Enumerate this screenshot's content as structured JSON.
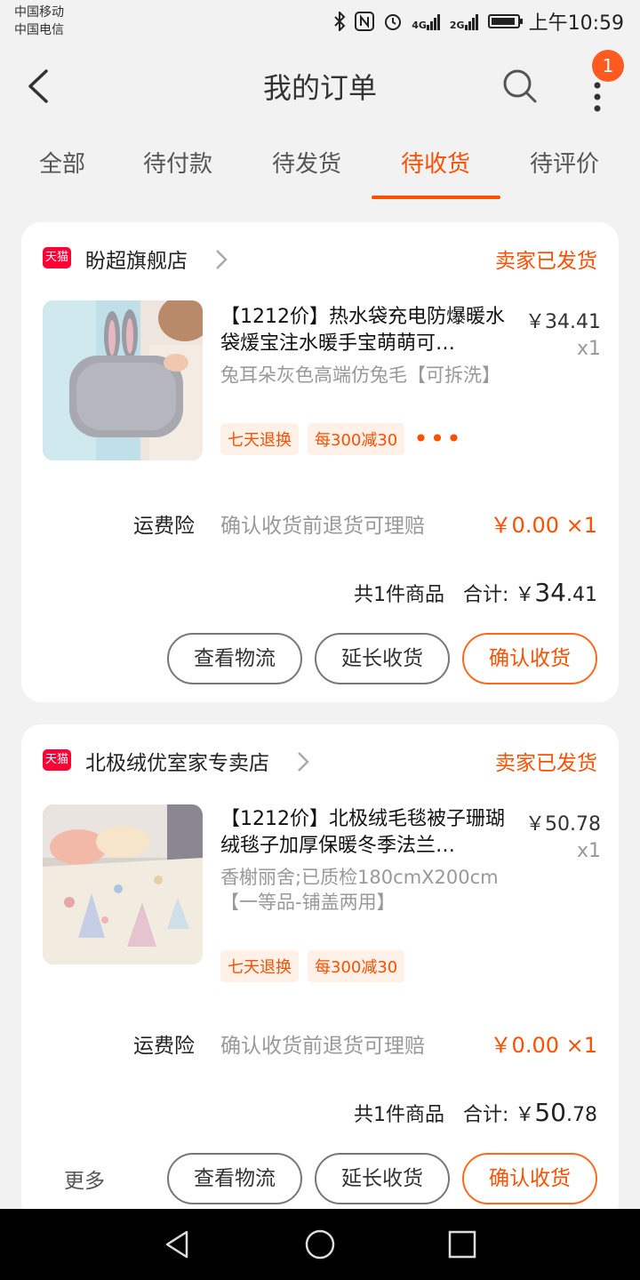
{
  "status_bar": {
    "carrier1": "中国移动",
    "carrier2": "中国电信",
    "net1": "4G",
    "net2": "2G",
    "time": "上午10:59"
  },
  "header": {
    "title": "我的订单",
    "badge_count": "1"
  },
  "tabs": [
    {
      "label": "全部"
    },
    {
      "label": "待付款"
    },
    {
      "label": "待发货"
    },
    {
      "label": "待收货",
      "active": true
    },
    {
      "label": "待评价"
    }
  ],
  "orders": [
    {
      "shop_tag": "天猫",
      "shop_name": "盼超旗舰店",
      "status": "卖家已发货",
      "title": "【1212价】热水袋充电防爆暖水袋煖宝注水暖手宝萌萌可…",
      "sku": "兔耳朵灰色高端仿兔毛【可拆洗】",
      "price": "￥34.41",
      "qty": "x1",
      "tags": [
        "七天退换",
        "每300减30"
      ],
      "tags_more": "•••",
      "insurance_label": "运费险",
      "insurance_desc": "确认收货前退货可理赔",
      "insurance_price": "￥0.00 ×1",
      "count_text": "共1件商品",
      "total_prefix": "合计: ￥",
      "total_int": "34",
      "total_dec": ".41",
      "buttons": [
        "查看物流",
        "延长收货",
        "确认收货"
      ]
    },
    {
      "shop_tag": "天猫",
      "shop_name": "北极绒优室家专卖店",
      "status": "卖家已发货",
      "title": "【1212价】北极绒毛毯被子珊瑚绒毯子加厚保暖冬季法兰…",
      "sku": "香榭丽舍;已质检180cmX200cm【一等品-铺盖两用】",
      "price": "￥50.78",
      "qty": "x1",
      "tags": [
        "七天退换",
        "每300减30"
      ],
      "insurance_label": "运费险",
      "insurance_desc": "确认收货前退货可理赔",
      "insurance_price": "￥0.00 ×1",
      "count_text": "共1件商品",
      "total_prefix": "合计: ￥",
      "total_int": "50",
      "total_dec": ".78",
      "buttons": [
        "查看物流",
        "延长收货",
        "确认收货"
      ],
      "more_label": "更多"
    }
  ],
  "colors": {
    "accent": "#ff5000",
    "tmall_red": "#ff0036",
    "background": "#f2f2f2"
  }
}
